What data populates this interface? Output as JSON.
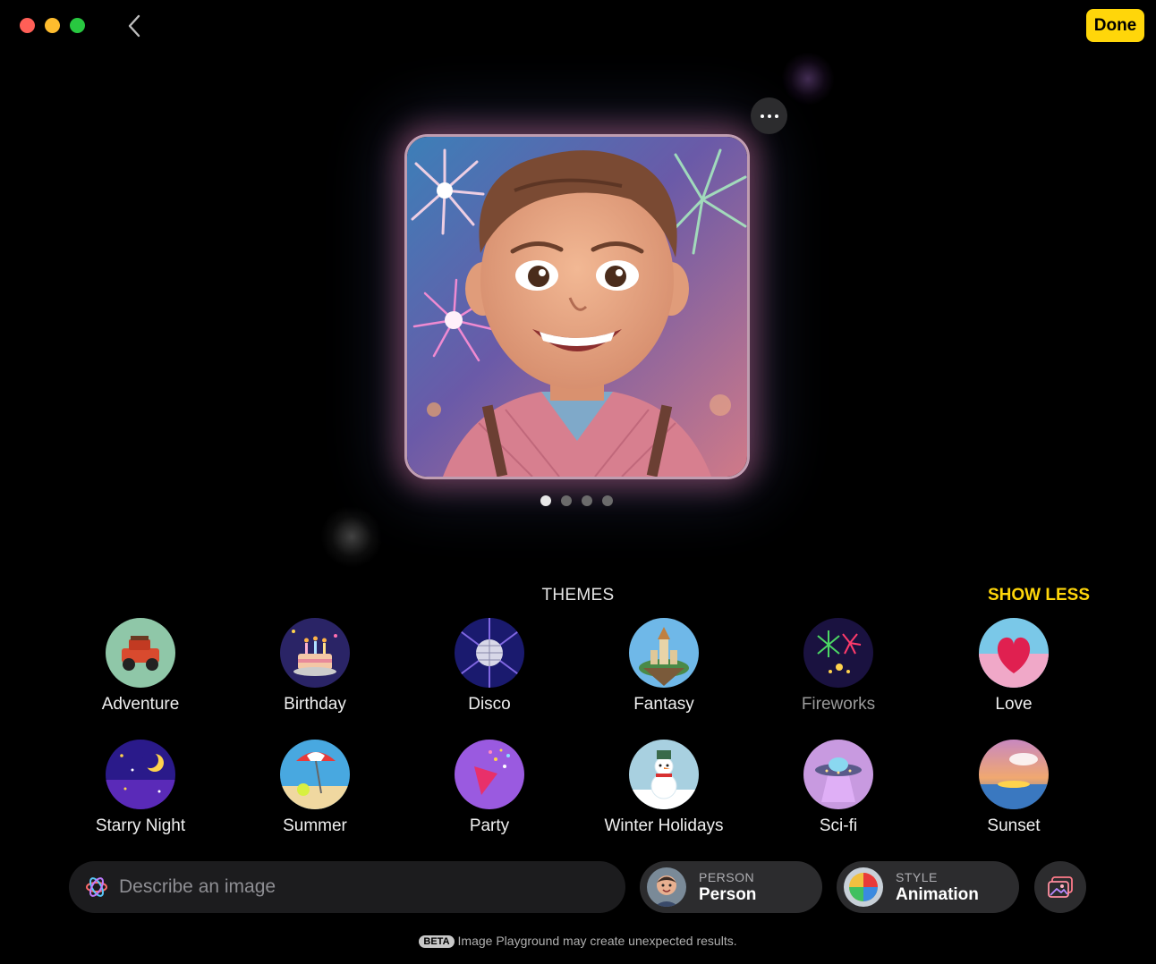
{
  "header": {
    "done_label": "Done"
  },
  "themes": {
    "title": "THEMES",
    "toggle_label": "SHOW LESS",
    "items": [
      {
        "label": "Adventure"
      },
      {
        "label": "Birthday"
      },
      {
        "label": "Disco"
      },
      {
        "label": "Fantasy"
      },
      {
        "label": "Fireworks"
      },
      {
        "label": "Love"
      },
      {
        "label": "Starry Night"
      },
      {
        "label": "Summer"
      },
      {
        "label": "Party"
      },
      {
        "label": "Winter Holidays"
      },
      {
        "label": "Sci-fi"
      },
      {
        "label": "Sunset"
      }
    ]
  },
  "prompt": {
    "placeholder": "Describe an image",
    "value": ""
  },
  "person": {
    "caption": "PERSON",
    "value": "Person"
  },
  "style": {
    "caption": "STYLE",
    "value": "Animation"
  },
  "footer": {
    "badge": "BETA",
    "text": "Image Playground may create unexpected results."
  },
  "carousel": {
    "pages": 4,
    "current": 1
  },
  "colors": {
    "accent": "#ffd60a",
    "background": "#000000",
    "pill": "#2c2c2e",
    "field": "#1c1c1e"
  }
}
